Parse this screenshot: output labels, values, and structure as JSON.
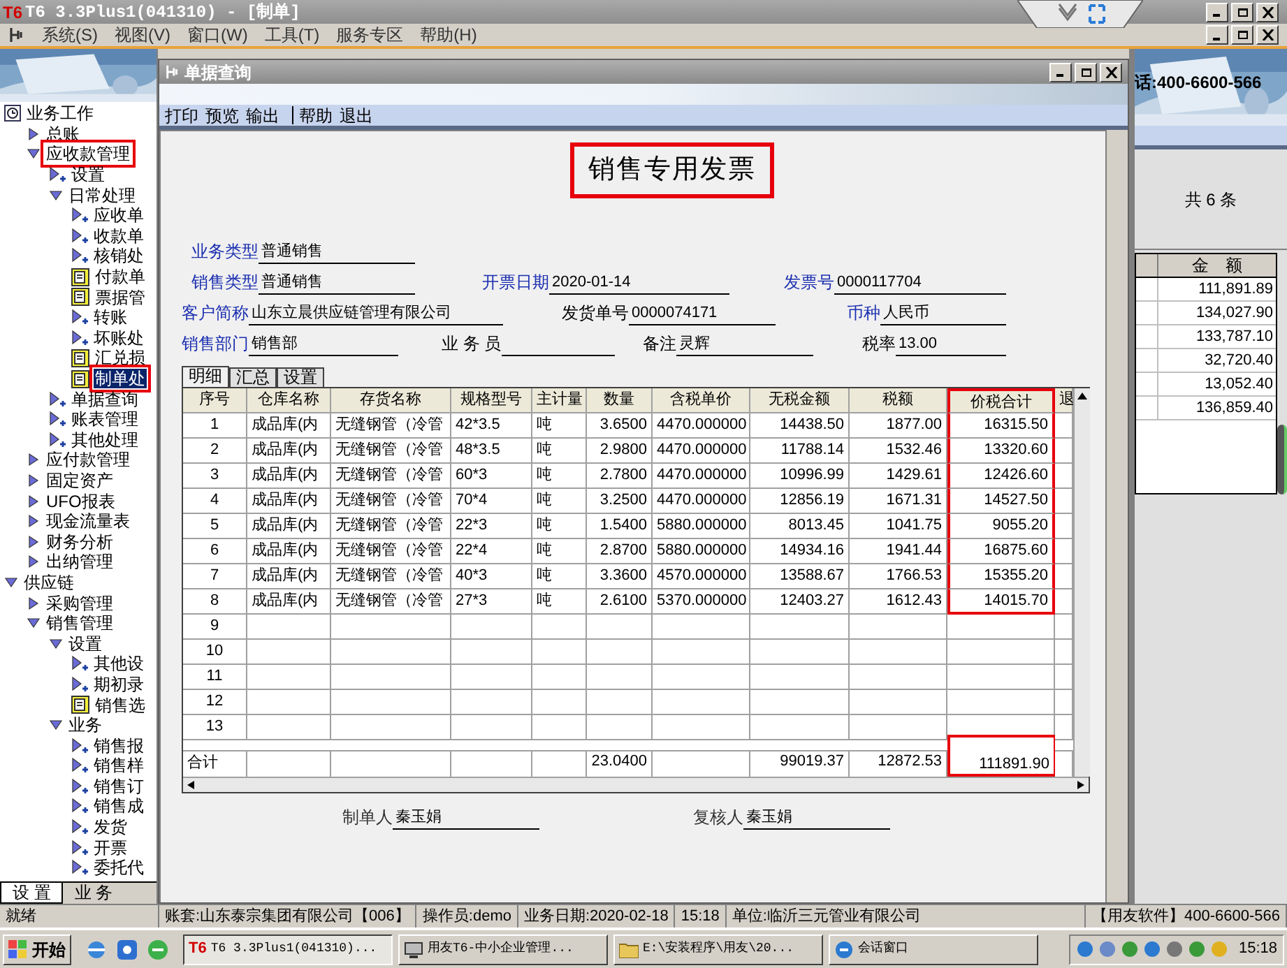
{
  "window": {
    "logo": "T6",
    "title": "T6 3.3Plus1(041310) - [制单]"
  },
  "menu": [
    "系统(S)",
    "视图(V)",
    "窗口(W)",
    "工具(T)",
    "服务专区",
    "帮助(H)"
  ],
  "sidebar": {
    "items": [
      {
        "label": "业务工作",
        "kind": "root",
        "expanded": true,
        "selected": false,
        "highlight": false,
        "children": [
          {
            "label": "总账",
            "kind": "folder",
            "expanded": false,
            "selected": false,
            "highlight": false
          },
          {
            "label": "应收款管理",
            "kind": "folder",
            "expanded": true,
            "selected": false,
            "highlight": true,
            "children": [
              {
                "label": "设置",
                "kind": "node",
                "selected": false,
                "highlight": false
              },
              {
                "label": "日常处理",
                "kind": "folder",
                "expanded": true,
                "selected": false,
                "highlight": false,
                "children": [
                  {
                    "label": "应收单",
                    "kind": "node",
                    "selected": false,
                    "highlight": false
                  },
                  {
                    "label": "收款单",
                    "kind": "node",
                    "selected": false,
                    "highlight": false
                  },
                  {
                    "label": "核销处",
                    "kind": "node",
                    "selected": false,
                    "highlight": false
                  },
                  {
                    "label": "付款单",
                    "kind": "form",
                    "selected": false,
                    "highlight": false
                  },
                  {
                    "label": "票据管",
                    "kind": "form",
                    "selected": false,
                    "highlight": false
                  },
                  {
                    "label": "转账",
                    "kind": "node",
                    "selected": false,
                    "highlight": false
                  },
                  {
                    "label": "坏账处",
                    "kind": "node",
                    "selected": false,
                    "highlight": false
                  },
                  {
                    "label": "汇兑损",
                    "kind": "form",
                    "selected": false,
                    "highlight": false
                  },
                  {
                    "label": "制单处",
                    "kind": "form",
                    "selected": true,
                    "highlight": true
                  }
                ]
              },
              {
                "label": "单据查询",
                "kind": "node",
                "selected": false,
                "highlight": false
              },
              {
                "label": "账表管理",
                "kind": "node",
                "selected": false,
                "highlight": false
              },
              {
                "label": "其他处理",
                "kind": "node",
                "selected": false,
                "highlight": false
              }
            ]
          },
          {
            "label": "应付款管理",
            "kind": "folder",
            "expanded": false,
            "selected": false,
            "highlight": false
          },
          {
            "label": "固定资产",
            "kind": "folder",
            "expanded": false,
            "selected": false,
            "highlight": false
          },
          {
            "label": "UFO报表",
            "kind": "folder",
            "expanded": false,
            "selected": false,
            "highlight": false
          },
          {
            "label": "现金流量表",
            "kind": "folder",
            "expanded": false,
            "selected": false,
            "highlight": false
          },
          {
            "label": "财务分析",
            "kind": "folder",
            "expanded": false,
            "selected": false,
            "highlight": false
          },
          {
            "label": "出纳管理",
            "kind": "folder",
            "expanded": false,
            "selected": false,
            "highlight": false
          }
        ]
      },
      {
        "label": "供应链",
        "kind": "folder",
        "expanded": true,
        "selected": false,
        "highlight": false,
        "children": [
          {
            "label": "采购管理",
            "kind": "folder",
            "expanded": false,
            "selected": false,
            "highlight": false
          },
          {
            "label": "销售管理",
            "kind": "folder",
            "expanded": true,
            "selected": false,
            "highlight": false,
            "children": [
              {
                "label": "设置",
                "kind": "folder",
                "expanded": true,
                "selected": false,
                "highlight": false,
                "children": [
                  {
                    "label": "其他设",
                    "kind": "node",
                    "selected": false,
                    "highlight": false
                  },
                  {
                    "label": "期初录",
                    "kind": "node",
                    "selected": false,
                    "highlight": false
                  },
                  {
                    "label": "销售选",
                    "kind": "form",
                    "selected": false,
                    "highlight": false
                  }
                ]
              },
              {
                "label": "业务",
                "kind": "folder",
                "expanded": true,
                "selected": false,
                "highlight": false,
                "children": [
                  {
                    "label": "销售报",
                    "kind": "node",
                    "selected": false,
                    "highlight": false
                  },
                  {
                    "label": "销售样",
                    "kind": "node",
                    "selected": false,
                    "highlight": false
                  },
                  {
                    "label": "销售订",
                    "kind": "node",
                    "selected": false,
                    "highlight": false
                  },
                  {
                    "label": "销售成",
                    "kind": "node",
                    "selected": false,
                    "highlight": false
                  },
                  {
                    "label": "发货",
                    "kind": "node",
                    "selected": false,
                    "highlight": false
                  },
                  {
                    "label": "开票",
                    "kind": "node",
                    "selected": false,
                    "highlight": false
                  },
                  {
                    "label": "委托代",
                    "kind": "node",
                    "selected": false,
                    "highlight": false
                  }
                ]
              }
            ]
          }
        ]
      }
    ],
    "tabs": [
      {
        "label": "设 置",
        "selected": true
      },
      {
        "label": "业 务",
        "selected": false
      }
    ]
  },
  "dialog": {
    "title": "单据查询",
    "toolbar": [
      [
        "打印",
        "预览",
        "输出"
      ],
      [
        "帮助",
        "退出"
      ]
    ],
    "invoice_title": {
      "text": "销售专用发票",
      "highlight": true
    },
    "form_rows": [
      [
        {
          "label": "业务类型",
          "value": "普通销售",
          "required": true
        }
      ],
      [
        {
          "label": "销售类型",
          "value": "普通销售",
          "required": true
        },
        {
          "label": "开票日期",
          "value": "2020-01-14",
          "required": true
        },
        {
          "label": "发票号",
          "value": "0000117704",
          "required": true
        }
      ],
      [
        {
          "label": "客户简称",
          "value": "山东立晨供应链管理有限公司",
          "required": true
        },
        {
          "label": "发货单号",
          "value": "0000074171",
          "required": false
        },
        {
          "label": "币种",
          "value": "人民币",
          "required": true
        }
      ],
      [
        {
          "label": "销售部门",
          "value": "销售部",
          "required": true
        },
        {
          "label": "业 务 员",
          "required": false
        },
        {
          "label": "备注",
          "value": "灵辉",
          "required": false
        },
        {
          "label": "税率",
          "value": "13.00",
          "required": false
        }
      ]
    ],
    "tabs": [
      {
        "label": "明细",
        "selected": true
      },
      {
        "label": "汇总",
        "selected": false
      },
      {
        "label": "设置",
        "selected": false
      }
    ],
    "table": {
      "columns": [
        {
          "label": "序号",
          "highlight": false
        },
        {
          "label": "仓库名称",
          "highlight": false
        },
        {
          "label": "存货名称",
          "highlight": false
        },
        {
          "label": "规格型号",
          "highlight": false
        },
        {
          "label": "主计量",
          "highlight": false
        },
        {
          "label": "数量",
          "highlight": false
        },
        {
          "label": "含税单价",
          "highlight": false
        },
        {
          "label": "无税金额",
          "highlight": false
        },
        {
          "label": "税额",
          "highlight": false
        },
        {
          "label": "价税合计",
          "highlight": true
        },
        {
          "label": "退",
          "highlight": false
        }
      ],
      "rows": [
        [
          "1",
          "成品库(内",
          "无缝钢管（冷管",
          "42*3.5",
          "吨",
          "3.6500",
          "4470.000000",
          "14438.50",
          "1877.00",
          "16315.50"
        ],
        [
          "2",
          "成品库(内",
          "无缝钢管（冷管",
          "48*3.5",
          "吨",
          "2.9800",
          "4470.000000",
          "11788.14",
          "1532.46",
          "13320.60"
        ],
        [
          "3",
          "成品库(内",
          "无缝钢管（冷管",
          "60*3",
          "吨",
          "2.7800",
          "4470.000000",
          "10996.99",
          "1429.61",
          "12426.60"
        ],
        [
          "4",
          "成品库(内",
          "无缝钢管（冷管",
          "70*4",
          "吨",
          "3.2500",
          "4470.000000",
          "12856.19",
          "1671.31",
          "14527.50"
        ],
        [
          "5",
          "成品库(内",
          "无缝钢管（冷管",
          "22*3",
          "吨",
          "1.5400",
          "5880.000000",
          "8013.45",
          "1041.75",
          "9055.20"
        ],
        [
          "6",
          "成品库(内",
          "无缝钢管（冷管",
          "22*4",
          "吨",
          "2.8700",
          "5880.000000",
          "14934.16",
          "1941.44",
          "16875.60"
        ],
        [
          "7",
          "成品库(内",
          "无缝钢管（冷管",
          "40*3",
          "吨",
          "3.3600",
          "4570.000000",
          "13588.67",
          "1766.53",
          "15355.20"
        ],
        [
          "8",
          "成品库(内",
          "无缝钢管（冷管",
          "27*3",
          "吨",
          "2.6100",
          "5370.000000",
          "12403.27",
          "1612.43",
          "14015.70"
        ],
        [
          "9"
        ],
        [
          "10"
        ],
        [
          "11"
        ],
        [
          "12"
        ],
        [
          "13"
        ]
      ],
      "total": {
        "label": "合计",
        "cells": [
          {
            "highlight": false
          },
          {
            "highlight": false
          },
          {
            "highlight": false
          },
          {
            "highlight": false
          },
          {
            "value": "23.0400",
            "highlight": false
          },
          {
            "highlight": false
          },
          {
            "value": "99019.37",
            "highlight": false
          },
          {
            "value": "12872.53",
            "highlight": false
          },
          {
            "value": "111891.90",
            "highlight": true
          },
          {
            "highlight": false
          }
        ]
      }
    },
    "signatures": [
      {
        "label": "制单人",
        "value": "秦玉娟"
      },
      {
        "label": "复核人",
        "value": "秦玉娟"
      }
    ]
  },
  "background_panel": {
    "phone": "话:400-6600-566",
    "count": "共 6 条",
    "column": "金　额",
    "amounts": [
      "111,891.89",
      "134,027.90",
      "133,787.10",
      "32,720.40",
      "13,052.40",
      "136,859.40"
    ]
  },
  "status_bar": [
    "就绪",
    "账套:山东泰宗集团有限公司【006】",
    "操作员:demo",
    "业务日期:2020-02-18",
    "15:18",
    "单位:临沂三元管业有限公司",
    "【用友软件】400-6600-566"
  ],
  "taskbar": {
    "start": "开始",
    "tasks": [
      {
        "label": "T6 3.3Plus1(041310)...",
        "logo": "T6",
        "selected": true
      },
      {
        "label": "用友T6-中小企业管理...",
        "selected": false
      },
      {
        "label": "E:\\安装程序\\用友\\20...",
        "selected": false
      },
      {
        "label": "会话窗口",
        "selected": false
      }
    ],
    "clock": "15:18"
  }
}
